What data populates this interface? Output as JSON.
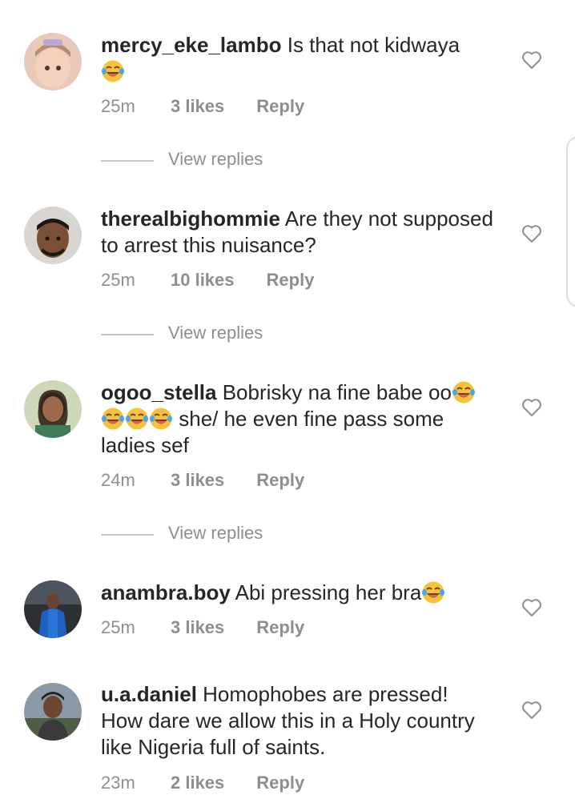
{
  "comments": [
    {
      "username": "mercy_eke_lambo",
      "text": "Is that not kidwaya",
      "emoji_after": 1,
      "time": "25m",
      "likes": "3 likes",
      "reply": "Reply",
      "view_replies": "View replies"
    },
    {
      "username": "therealbighommie",
      "text": "Are they not supposed to arrest this nuisance?",
      "time": "25m",
      "likes": "10 likes",
      "reply": "Reply",
      "view_replies": "View replies"
    },
    {
      "username": "ogoo_stella",
      "text_part1": "Bobrisky na fine babe oo",
      "text_part2": "she/ he even fine pass some ladies sef",
      "emoji_mid_1": 1,
      "emoji_mid_2": 3,
      "time": "24m",
      "likes": "3 likes",
      "reply": "Reply",
      "view_replies": "View replies"
    },
    {
      "username": "anambra.boy",
      "text": "Abi pressing her bra",
      "emoji_after": 1,
      "time": "25m",
      "likes": "3 likes",
      "reply": "Reply"
    },
    {
      "username": "u.a.daniel",
      "text": "Homophobes are pressed! How dare  we allow this in a Holy country like Nigeria full of saints.",
      "time": "23m",
      "likes": "2 likes",
      "reply": "Reply"
    }
  ],
  "icons": {
    "like": "heart-outline-icon",
    "emoji": "face-with-tears-of-joy-emoji"
  },
  "colors": {
    "text": "#262626",
    "secondary": "#8e8e8e",
    "divider": "#c7c7c7"
  }
}
